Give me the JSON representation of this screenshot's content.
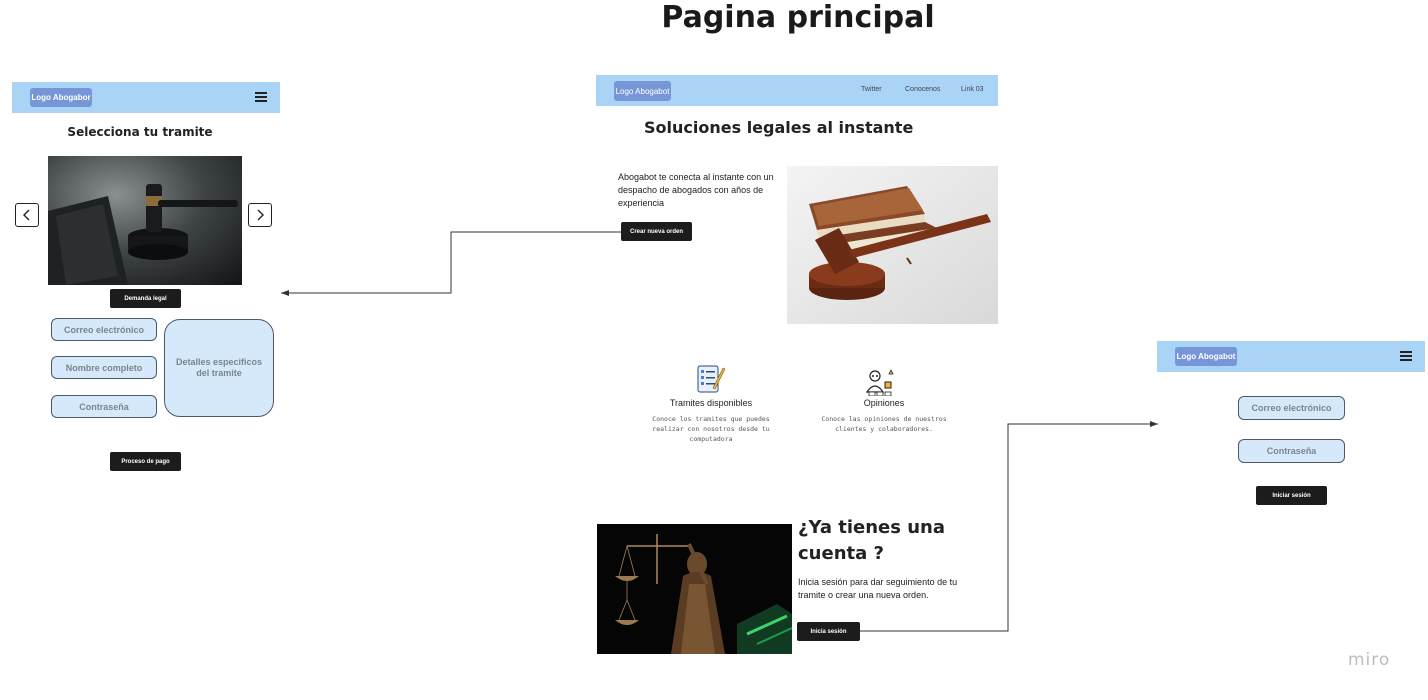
{
  "board": {
    "title": "Pagina principal",
    "watermark": "miro"
  },
  "colors": {
    "navbar": "#a9d4f5",
    "logo": "#7796d8",
    "field_fill": "#d6e9fa",
    "dark_button": "#1c1c1c"
  },
  "left_screen": {
    "logo": "Logo Abogabor",
    "menu_icon": "hamburger-menu-icon",
    "heading": "Selecciona tu tramite",
    "carousel_prev_icon": "chevron-left-icon",
    "carousel_next_icon": "chevron-right-icon",
    "image_caption_button": "Demanda legal",
    "fields": {
      "email": "Correo electrónico",
      "full_name": "Nombre completo",
      "password": "Contraseña",
      "details": "Detalles especificos del tramite"
    },
    "payment_button": "Proceso de pago"
  },
  "center_screen": {
    "logo": "Logo Abogabot",
    "nav_links": [
      "Twitter",
      "Conocenos",
      "Link 03"
    ],
    "hero_title": "Soluciones legales al instante",
    "hero_text": "Abogabot te conecta al instante con un despacho de abogados con años de experiencia",
    "hero_button": "Crear nueva orden",
    "features": [
      {
        "icon": "checklist-icon",
        "title": "Tramites disponibles",
        "text": "Conoce los tramites que puedes realizar con nosotros desde tu computadora"
      },
      {
        "icon": "reviews-icon",
        "title": "Opiniones",
        "text": "Conoce las opiniones de nuestros clientes y colaboradores."
      }
    ],
    "account_title_line1": "¿Ya tienes una",
    "account_title_line2": "cuenta ?",
    "account_text": "Inicia sesión para dar seguimiento de tu tramite o crear una nueva orden.",
    "account_button": "Inicia sesión"
  },
  "right_screen": {
    "logo": "Logo Abogabot",
    "menu_icon": "hamburger-menu-icon",
    "fields": {
      "email": "Correo electrónico",
      "password": "Contraseña"
    },
    "login_button": "Iniciar sesión"
  }
}
